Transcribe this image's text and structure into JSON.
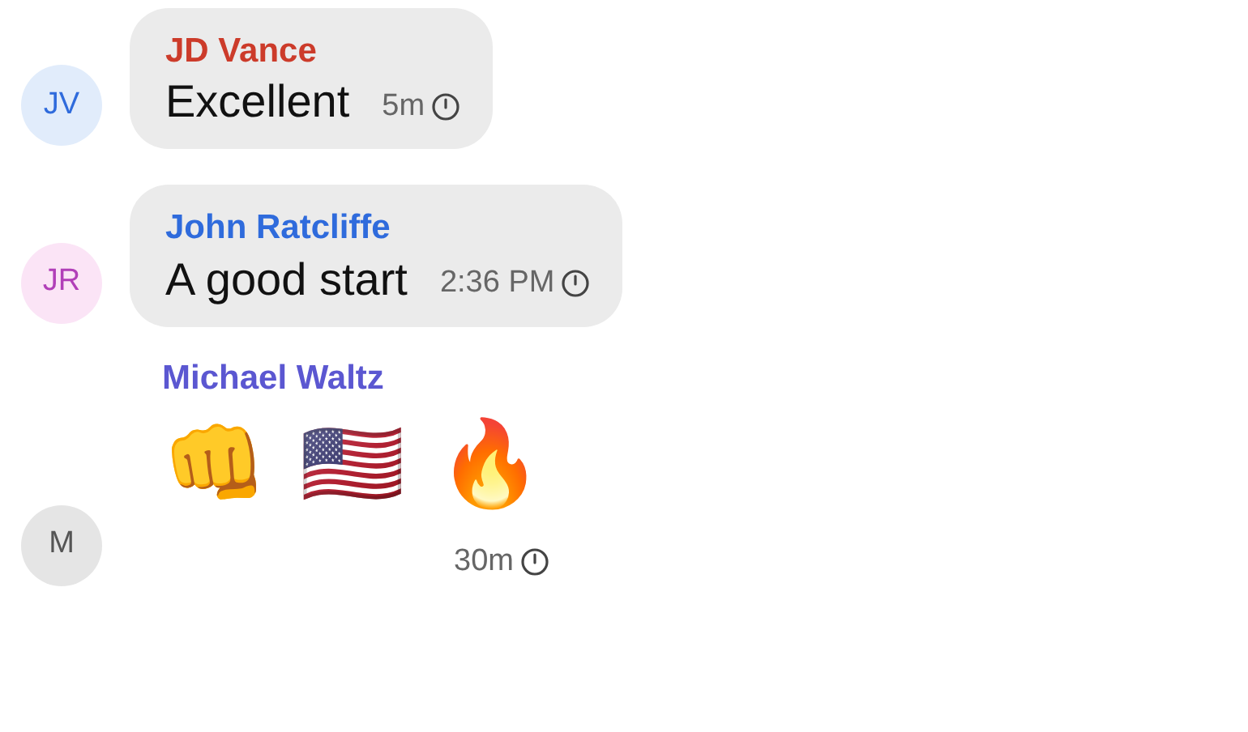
{
  "messages": [
    {
      "kind": "text",
      "avatar": {
        "initials": "JV",
        "color": "#e1ecfb"
      },
      "sender": "JD Vance",
      "color": "#cc3b2a",
      "text": "Excellent",
      "time": "5m"
    },
    {
      "kind": "text",
      "avatar": {
        "initials": "JR",
        "color": "#fbe4f6"
      },
      "sender": "John Ratcliffe",
      "color": "#2f6bdc",
      "text": "A good start",
      "time": "2:36 PM"
    },
    {
      "kind": "emoji",
      "avatar": {
        "initials": "M",
        "color": "#e5e5e5"
      },
      "sender": "Michael Waltz",
      "color": "#5b57d1",
      "emojis": [
        "👊",
        "🇺🇸",
        "🔥"
      ],
      "time": "30m"
    }
  ]
}
